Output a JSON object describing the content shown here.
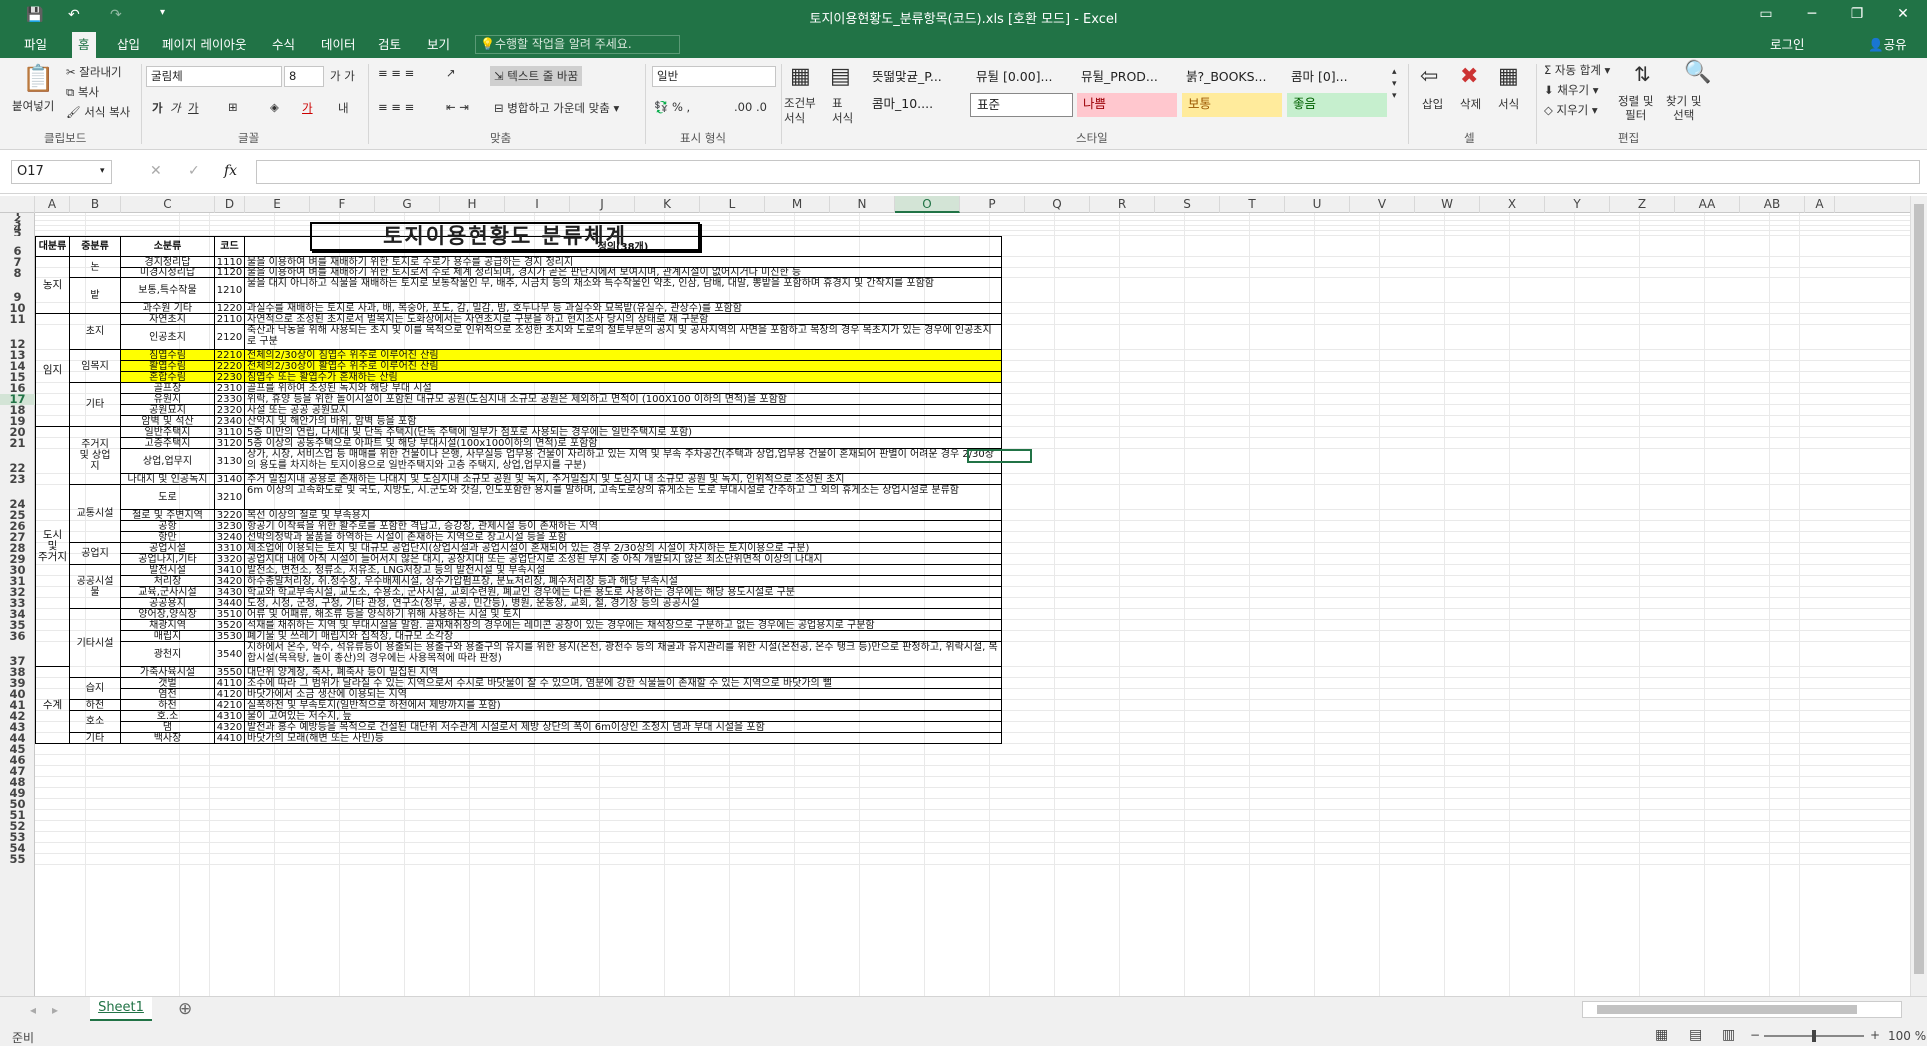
{
  "window": {
    "title": "토지이용현황도_분류항목(코드).xls  [호환 모드] - Excel"
  },
  "tabs": [
    "파일",
    "홈",
    "삽입",
    "페이지 레이아웃",
    "수식",
    "데이터",
    "검토",
    "보기"
  ],
  "tell_me": "수행할 작업을 알려 주세요.",
  "account": {
    "login": "로그인",
    "share": "공유"
  },
  "clipboard": {
    "paste": "붙여넣기",
    "cut": "잘라내기",
    "copy": "복사",
    "format_painter": "서식 복사",
    "label": "클립보드"
  },
  "font": {
    "name": "굴림체",
    "size": "8",
    "label": "글꼴"
  },
  "align": {
    "wrap": "텍스트 줄 바꿈",
    "merge": "병합하고 가운데 맞춤",
    "label": "맞춤"
  },
  "number": {
    "format": "일반",
    "label": "표시 형식"
  },
  "styles": {
    "conditional": "조건부\n서식",
    "table": "표\n서식",
    "label": "스타일",
    "row1": [
      "뜻떪맟귣_P...",
      "뮤뒬 [0.00]...",
      "뮤뒬_PROD...",
      "붉?_BOOKS...",
      "콤마 [0]..."
    ],
    "row2": [
      "콤마_10....",
      "표준",
      "나쁨",
      "보통",
      "좋음"
    ]
  },
  "cells_group": {
    "insert": "삽입",
    "delete": "삭제",
    "format": "서식",
    "label": "셀"
  },
  "edit_group": {
    "autosum": "자동 합계",
    "fill": "채우기",
    "clear": "지우기",
    "sort": "정렬 및\n필터",
    "find": "찾기 및\n선택",
    "label": "편집"
  },
  "formula_bar": {
    "name_box": "O17",
    "fx": "fx",
    "value": ""
  },
  "columns": [
    "A",
    "B",
    "C",
    "D",
    "E",
    "F",
    "G",
    "H",
    "I",
    "J",
    "K",
    "L",
    "M",
    "N",
    "O",
    "P",
    "Q",
    "R",
    "S",
    "T",
    "U",
    "V",
    "W",
    "X",
    "Y",
    "Z",
    "AA",
    "AB",
    "A"
  ],
  "sheet_title": "토지이용현황도 분류체계",
  "headers": {
    "a": "대분류",
    "b": "중분류",
    "c": "소분류",
    "d": "코드",
    "e": "정의(38개)"
  },
  "rows": [
    {
      "c": "경지정리답",
      "d": "1110",
      "e": "물을 이용하여 벼를 재배하기 위한 토지로 수로가 용수를 공급하는 경지 정리지"
    },
    {
      "c": "미경지정리답",
      "d": "1120",
      "e": "물을 이용하여 벼를 재배하기 위한 토지로서 수로 체계 정리되며, 경지가 곧은 판단지에서 보여지며, 관계시설이 없어지거나 미진한 등"
    },
    {
      "c": "보통,특수작물",
      "d": "1210",
      "e": "물을 대지 아니하고 식물을 재배하는 토지로 보통작물인 무, 배추, 시금치 등의 채소와 특수작물인 약초, 인삼, 담배, 대말, 뽕밭을 포함하며 휴경지 및 간작지를 포함함"
    },
    {
      "c": "과수원 기타",
      "d": "1220",
      "e": "과실수를 재배하는 토지로 사과, 배, 복숭아, 포도, 감, 밀감, 밤, 호두나무 등 과실수와 묘목밭(유실수, 관상수)를 포함함"
    },
    {
      "c": "자연초지",
      "d": "2110",
      "e": "자연적으로 조성된 초지로서 벌목지는 도화상에서는 자연초지로 구분을 하고 현지조사 당시의 상태로 재 구분함"
    },
    {
      "c": "인공초지",
      "d": "2120",
      "e": "축산과 낙농을 위해 사용되는 초지 및 이를 목적으로 인위적으로 조성한 초지와 도로의 절토부분의 공지 및 공사지역의 사면을 포함하고 목장의 경우 목초지가 있는 경우에 인공초지로 구분"
    },
    {
      "c": "침엽수림",
      "d": "2210",
      "e": "전체의2/30상이 침엽수 위주로 이루어진 산림"
    },
    {
      "c": "활엽수림",
      "d": "2220",
      "e": "전체의2/30상이 활엽수 위주로 이루어진 산림"
    },
    {
      "c": "혼합수림",
      "d": "2230",
      "e": "침엽수 또는 활엽수가 혼재하는 산림"
    },
    {
      "c": "골프장",
      "d": "2310",
      "e": "골프를 위하여 조성된 녹지와 해당 부대 시설"
    },
    {
      "c": "유원지",
      "d": "2330",
      "e": "위락, 휴양 등을 위한 놀이시설이 포함된 대규모 공원(도심지내 소규모 공원은 제외하고 면적이 (100X100 이하의 면적)을 포함함"
    },
    {
      "c": "공원묘지",
      "d": "2320",
      "e": "사설 또는 공공 공원묘지"
    },
    {
      "c": "암벽 및 석산",
      "d": "2340",
      "e": "산악지 및 해안가의 바위, 암벽 등을 포함"
    },
    {
      "c": "일반주택지",
      "d": "3110",
      "e": "5층 미만의 연립, 다세대 및 단독 주택지(단독 주택에 일부가 점포로 사용되는 경우에는 일반주택지로 포함)"
    },
    {
      "c": "고층주택지",
      "d": "3120",
      "e": "5층 이상의 공동주택으로 아파트 및 해당 부대시설(100x100이하의 면적)로 포함함"
    },
    {
      "c": "상업,업무지",
      "d": "3130",
      "e": "상가, 시장, 서비스업 등 매매를 위한 건물이나 은행, 사무실등 업무용 건물이 자리하고 있는 지역 및 부속 주차공간(주택과 상업,업무용 건물이 혼재되어 판별이 어려운 경우 2/30상의 용도를 차지하는 토지이용으로 일반주택지와 고층 주택지, 상업,업무지를 구분)"
    },
    {
      "c": "나대지 및 인공녹지",
      "d": "3140",
      "e": "주거 밀집지내 공용로 존재하는 나대지 및 도심지내 소규모 공원 및 녹지, 주거밀집지 및 도심지 내 소규모 공원 및 녹지, 인위적으로 조성된 초지"
    },
    {
      "c": "도로",
      "d": "3210",
      "e": "6m 이상의 고속화도로 및 국도, 지방도, 시.군도와 갓길, 인도포함한 용지를 말하며, 고속도로상의 휴게소는 도로 부대시설로 간주하고 그 외의 휴게소는 상업시설로 분류함"
    },
    {
      "c": "철로 및 주변지역",
      "d": "3220",
      "e": "복선 이상의 철로 및 부속용지"
    },
    {
      "c": "공항",
      "d": "3230",
      "e": "항공기 이착륙을 위한 활주로를 포함한 격납고, 승강장, 관제시설 등이 존재하는 지역"
    },
    {
      "c": "항만",
      "d": "3240",
      "e": "선박의정박과 물품을 하역하는 시설이 존재하는 지역으로 창고시설 등을 포함"
    },
    {
      "c": "공업시설",
      "d": "3310",
      "e": "제조업에 이용되는 토지 및 대규모 공업단지(상업시설과 공업시설이 혼재되어 있는 경우 2/30상의 시설이 차지하는 토지이용으로 구분)"
    },
    {
      "c": "공업나지,기타",
      "d": "3320",
      "e": "공업지대 내에 아직 시설이 들어서지 않은 대지, 공장지대 또는 공업단지로 조성된 부지 중 아직 개발되지 않은 최소단위면적 이상의 나대지"
    },
    {
      "c": "발전시설",
      "d": "3410",
      "e": "발전소, 변전소, 정류소, 저유조, LNG저장고 등의 발전시설 및 부속시설"
    },
    {
      "c": "처리장",
      "d": "3420",
      "e": "하수종말처리장, 취.정수장, 우수배제시설, 상수가압펌프장, 분뇨처리장, 폐수처리장 등과 해당 부속시설"
    },
    {
      "c": "교육,군사시설",
      "d": "3430",
      "e": "학교와 학교부속시설, 교도소, 수용소, 군사시설, 교회수련원, 폐교인 경우에는 다른 용도로 사용하는 경우에는 해당 용도시설로 구분"
    },
    {
      "c": "공공용지",
      "d": "3440",
      "e": "도청, 시청, 군청, 구청, 기타 관청, 연구소(정부, 공공, 민간등), 병원, 운동장, 교회, 절, 경기장 등의 공공시설"
    },
    {
      "c": "양어장,양식장",
      "d": "3510",
      "e": "어류 및 어패류, 해조류 등을 양식하기 위해 사용하는 시설 및 토지"
    },
    {
      "c": "채광지역",
      "d": "3520",
      "e": "석재를 채취하는 지역 및 부대시설을 말함. 골재채취장의 경우에는 레미콘 공장이 있는 경우에는 채석장으로 구분하고 없는 경우에는 공업용지로 구분함"
    },
    {
      "c": "매립지",
      "d": "3530",
      "e": "폐기물 및 쓰레기 매립지와 집적장, 대규모 소각장"
    },
    {
      "c": "광천지",
      "d": "3540",
      "e": "지하에서 온수, 약수, 석유류등이 용출되는 용출구와 용출구의 유지를 위한 용지(온천, 광천수 등의 채굴과 유지관리를 위한 시설(온천공, 온수 탱크 등)만으로 판정하고, 위락시설, 복합시설(목욕탕, 놀이 종산)의 경우에는 사용목적에 따라 판정)"
    },
    {
      "c": "가축사육시설",
      "d": "3550",
      "e": "대단위 양계장, 축사, 폐축사 등이 밀집된 지역"
    },
    {
      "c": "갯벌",
      "d": "4110",
      "e": "조수에 따라 그 범위가 달라질 수 있는 지역으로서 수시로 바닷물이 찰 수 있으며, 염분에 강한 식물들이 존재할 수 있는 지역으로 바닷가의 뻘"
    },
    {
      "c": "염전",
      "d": "4120",
      "e": "바닷가에서 소금 생산에 이용되는 지역"
    },
    {
      "c": "하천",
      "d": "4210",
      "e": "실폭하천 및 부속토지(일반적으로 하천에서 제방까지를 포함)"
    },
    {
      "c": "호.소",
      "d": "4310",
      "e": "물이 고여있는 저수지, 늪"
    },
    {
      "c": "댐",
      "d": "4320",
      "e": "발전과 홍수 예방등을 목적으로 건설된 대단위 저수관계 시설로서 제방 상단의 폭이 6m이상인 조정지 댐과 부대 시설을 포함"
    },
    {
      "c": "백사장",
      "d": "4410",
      "e": "바닷가의 모래(해변 또는 사빈)등"
    }
  ],
  "groups_a": [
    "농지",
    "임지",
    "도시\n및\n주거지",
    "수계"
  ],
  "groups_b": [
    "논",
    "밭",
    "초지",
    "임목지",
    "기타",
    "주거지\n및 상업\n지",
    "교통시설",
    "공업지",
    "공공시설\n물",
    "기타시설",
    "습지",
    "하천",
    "호소",
    "기타"
  ],
  "sheet_tab": "Sheet1",
  "status": {
    "ready": "준비",
    "zoom": "100 %"
  }
}
